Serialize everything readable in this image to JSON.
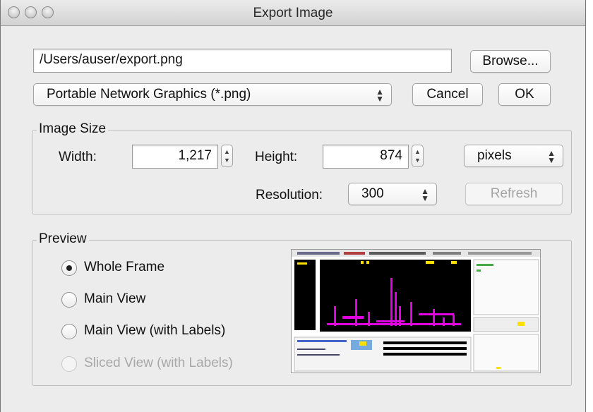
{
  "window": {
    "title": "Export Image"
  },
  "file": {
    "path": "/Users/auser/export.png",
    "browse_label": "Browse...",
    "format": "Portable Network Graphics (*.png)",
    "cancel_label": "Cancel",
    "ok_label": "OK"
  },
  "image_size": {
    "group_title": "Image Size",
    "width_label": "Width:",
    "width_value": "1,217",
    "height_label": "Height:",
    "height_value": "874",
    "unit": "pixels",
    "resolution_label": "Resolution:",
    "resolution_value": "300",
    "refresh_label": "Refresh"
  },
  "preview": {
    "group_title": "Preview",
    "options": [
      {
        "label": "Whole Frame",
        "selected": true,
        "enabled": true
      },
      {
        "label": "Main View",
        "selected": false,
        "enabled": true
      },
      {
        "label": "Main View (with Labels)",
        "selected": false,
        "enabled": true
      },
      {
        "label": "Sliced View (with Labels)",
        "selected": false,
        "enabled": false
      }
    ]
  },
  "colors": {
    "window_bg": "#ececec",
    "preview_dark": "#000000",
    "preview_magenta": "#e000e0",
    "preview_yellow": "#ffe000"
  }
}
